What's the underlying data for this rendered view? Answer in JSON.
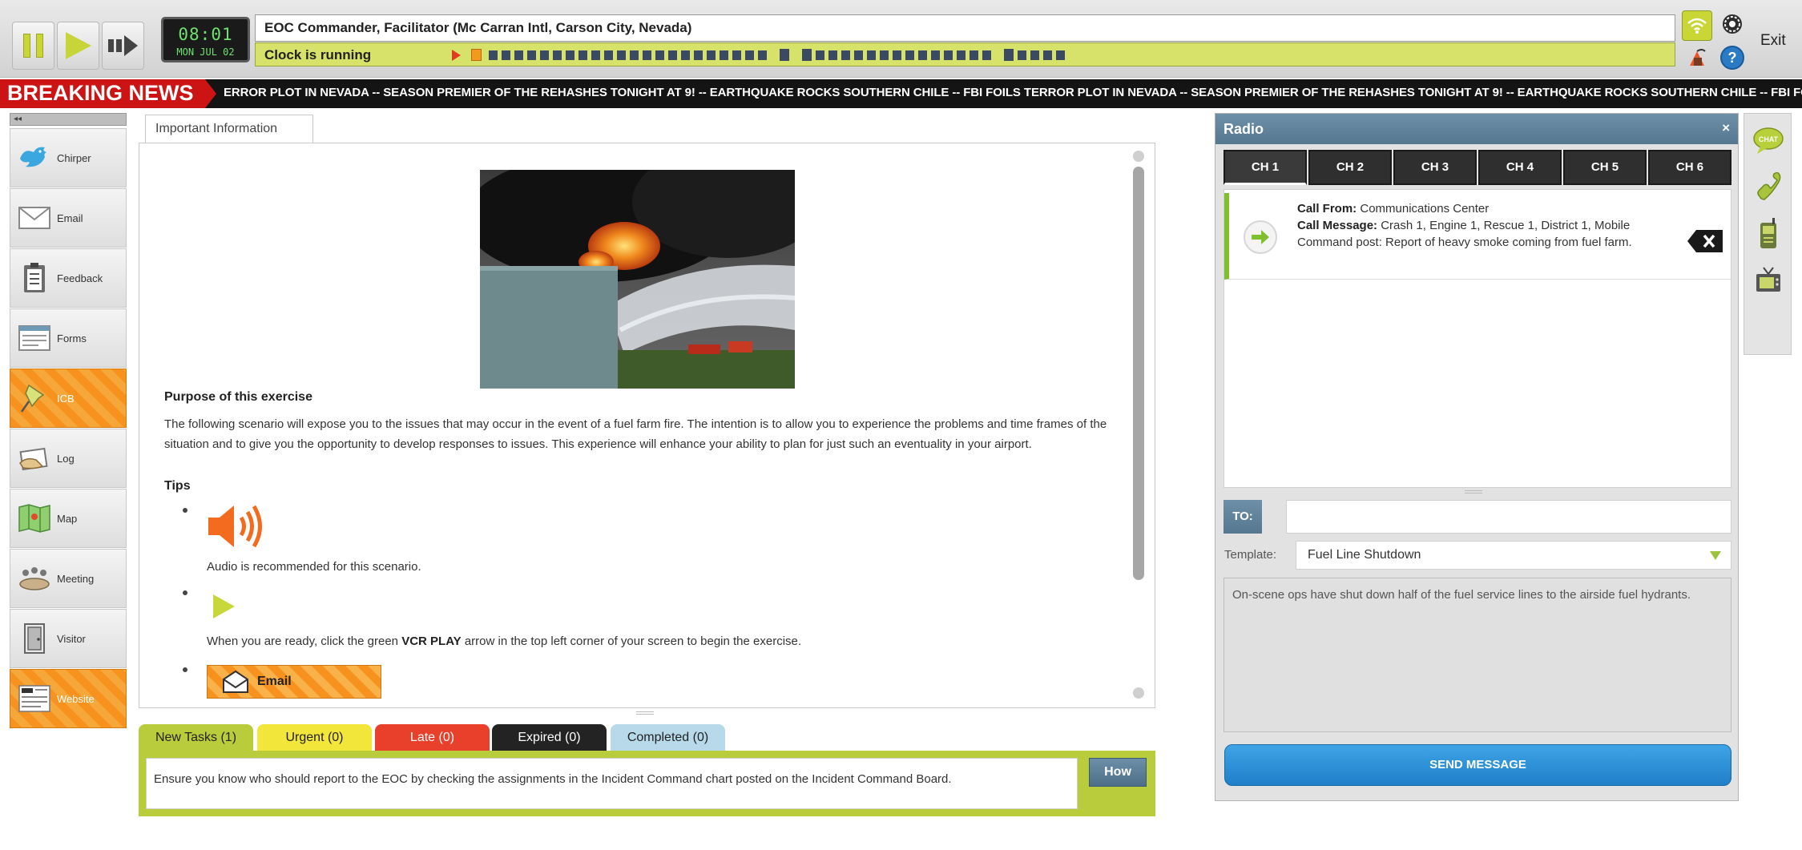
{
  "topbar": {
    "clock_time": "08:01",
    "clock_date": "MON JUL 02",
    "role": "EOC Commander, Facilitator (Mc Carran Intl, Carson City, Nevada)",
    "clock_status": "Clock is running",
    "exit_label": "Exit"
  },
  "news": {
    "label": "BREAKING NEWS",
    "ticker": "ERROR PLOT IN NEVADA -- SEASON PREMIER OF THE REHASHES TONIGHT AT 9! -- EARTHQUAKE ROCKS SOUTHERN CHILE -- FBI FOILS TERROR PLOT IN NEVADA -- SEASON PREMIER OF THE REHASHES TONIGHT AT 9! -- EARTHQUAKE ROCKS SOUTHERN CHILE -- FBI FOILS TERROR PLOT IN"
  },
  "sidebar": {
    "collapse_label": "◂◂",
    "items": [
      {
        "label": "Chirper",
        "icon": "bird-icon"
      },
      {
        "label": "Email",
        "icon": "envelope-icon"
      },
      {
        "label": "Feedback",
        "icon": "clipboard-icon"
      },
      {
        "label": "Forms",
        "icon": "form-icon"
      },
      {
        "label": "ICB",
        "icon": "pushpin-icon"
      },
      {
        "label": "Log",
        "icon": "log-hand-icon"
      },
      {
        "label": "Map",
        "icon": "map-icon"
      },
      {
        "label": "Meeting",
        "icon": "meeting-icon"
      },
      {
        "label": "Visitor",
        "icon": "door-icon"
      },
      {
        "label": "Website",
        "icon": "news-website-icon"
      }
    ]
  },
  "main": {
    "tab_label": "Important Information",
    "purpose_title": "Purpose of this exercise",
    "purpose_text": "The following scenario will expose you to the issues that may occur in the event of a fuel farm fire.   The intention is to allow you to experience the problems and time frames of the situation and to give you the opportunity to develop responses to issues. This experience will enhance your ability to plan for just such an eventuality in your airport.",
    "tips_title": "Tips",
    "audio_tip": "Audio is recommended for this scenario.",
    "play_tip_before": "When you are ready, click the green ",
    "play_tip_bold": "VCR PLAY",
    "play_tip_after": " arrow in the top left corner of your screen to begin the exercise.",
    "email_button": "Email"
  },
  "tasks": {
    "tabs": [
      "New Tasks (1)",
      "Urgent (0)",
      "Late (0)",
      "Expired (0)",
      "Completed (0)"
    ],
    "current_task": "Ensure you know who should report to the EOC by checking the assignments in the Incident Command chart posted on the Incident Command Board.",
    "how_label": "How"
  },
  "radio": {
    "title": "Radio",
    "close": "×",
    "channels": [
      "CH 1",
      "CH 2",
      "CH 3",
      "CH 4",
      "CH 5",
      "CH 6"
    ],
    "message": {
      "from_label": "Call From:",
      "from_value": " Communications Center",
      "msg_label": "Call Message:",
      "msg_value": "  Crash 1, Engine 1, Rescue 1, District 1, Mobile Command post: Report of heavy smoke coming from fuel farm."
    },
    "to_label": "TO:",
    "to_value": "",
    "template_label": "Template:",
    "template_value": "Fuel Line Shutdown",
    "body": "On-scene ops have shut down half of the fuel service lines to the airside fuel hydrants.",
    "send_label": "SEND MESSAGE"
  },
  "colors": {
    "accent_green": "#b9cc3c",
    "accent_orange": "#f7921e",
    "news_red": "#cc1414",
    "radio_header": "#607f97",
    "send_blue": "#2a8fd6"
  }
}
